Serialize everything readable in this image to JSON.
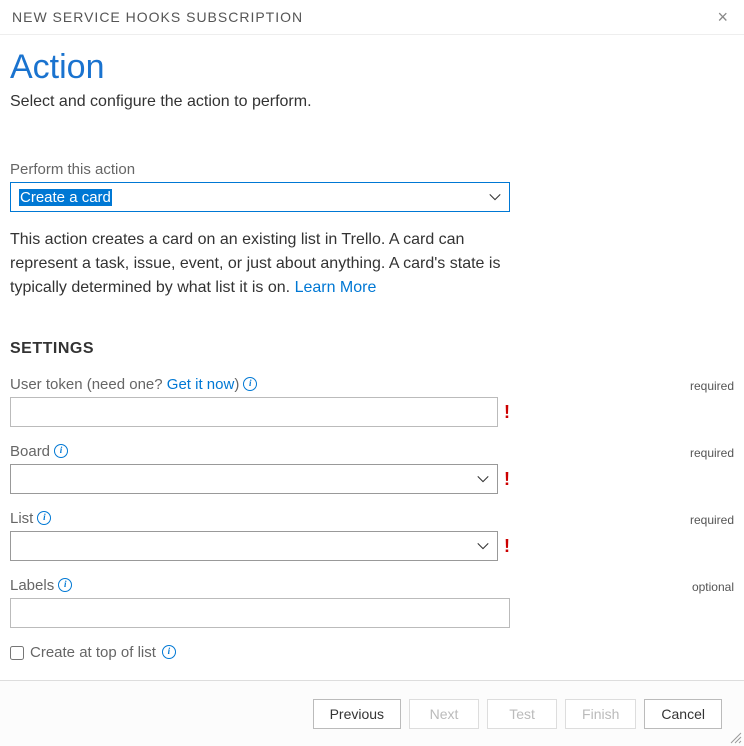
{
  "dialog": {
    "title": "NEW SERVICE HOOKS SUBSCRIPTION"
  },
  "page": {
    "heading": "Action",
    "subheading": "Select and configure the action to perform."
  },
  "action": {
    "label": "Perform this action",
    "selected": "Create a card",
    "description_part1": "This action creates a card on an existing list in Trello. A card can represent a task, issue, event, or just about anything. A card's state is typically determined by what list it is on. ",
    "learn_more": "Learn More"
  },
  "settings": {
    "heading": "SETTINGS",
    "required_label": "required",
    "optional_label": "optional",
    "user_token": {
      "label_prefix": "User token (need one? ",
      "link": "Get it now",
      "label_suffix": ")",
      "value": ""
    },
    "board": {
      "label": "Board",
      "value": ""
    },
    "list": {
      "label": "List",
      "value": ""
    },
    "labels": {
      "label": "Labels",
      "value": ""
    },
    "create_top": {
      "label": "Create at top of list",
      "checked": false
    }
  },
  "footer": {
    "previous": "Previous",
    "next": "Next",
    "test": "Test",
    "finish": "Finish",
    "cancel": "Cancel"
  }
}
